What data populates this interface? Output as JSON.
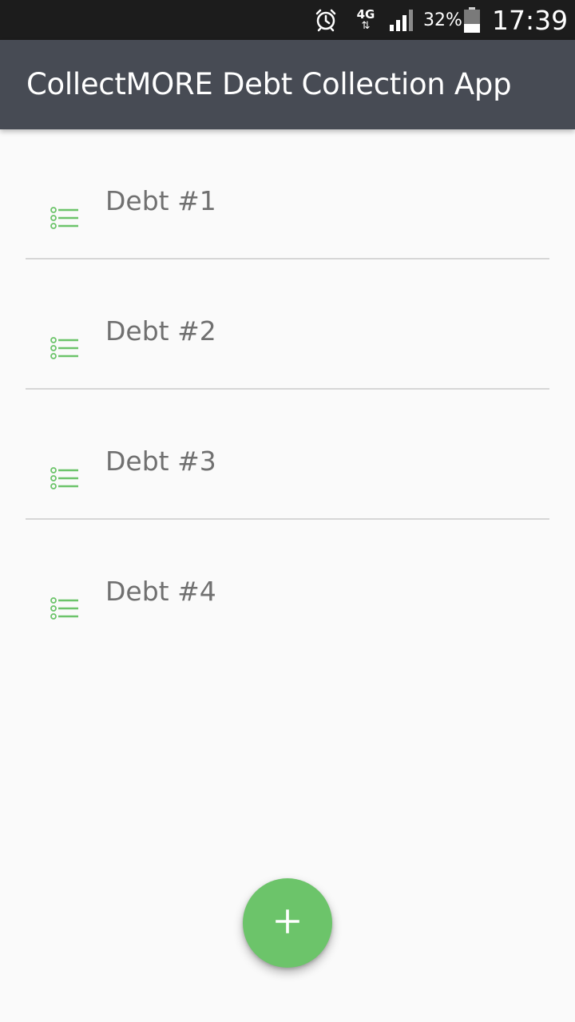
{
  "status_bar": {
    "network_label": "4G",
    "network_arrows": "⇅",
    "battery_percent": "32%",
    "time": "17:39",
    "icons": [
      "alarm-icon",
      "signal-icon",
      "battery-icon"
    ]
  },
  "app_bar": {
    "title": "CollectMORE Debt Collection App"
  },
  "debts": [
    {
      "label": "Debt #1",
      "icon": "list-icon"
    },
    {
      "label": "Debt #2",
      "icon": "list-icon"
    },
    {
      "label": "Debt #3",
      "icon": "list-icon"
    },
    {
      "label": "Debt #4",
      "icon": "list-icon"
    }
  ],
  "fab": {
    "icon": "plus-icon"
  },
  "colors": {
    "app_bar": "#474b54",
    "status_bar": "#1c1c1c",
    "accent": "#6cc46a",
    "background": "#fafafa",
    "item_text": "#707070",
    "divider": "#d6d6d6"
  }
}
